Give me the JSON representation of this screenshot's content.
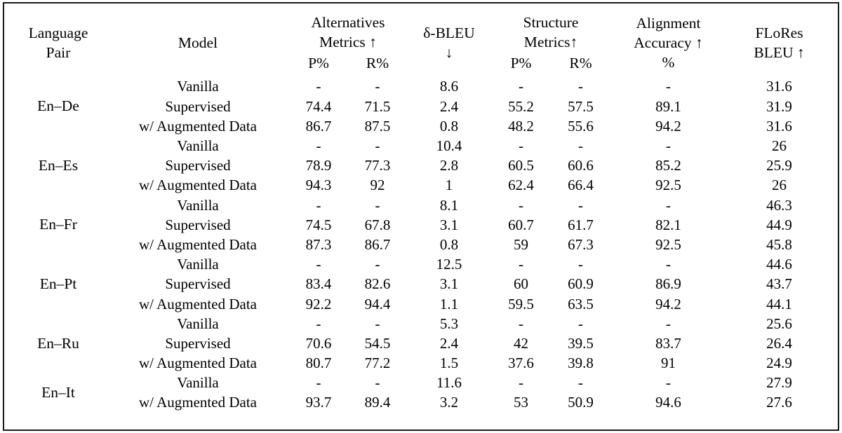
{
  "table": {
    "header": {
      "language_pair": [
        "Language",
        "Pair"
      ],
      "model": "Model",
      "alternatives": {
        "title_line1": "Alternatives",
        "title_line2": "Metrics ↑",
        "sub": [
          "P%",
          "R%"
        ]
      },
      "delta_bleu": {
        "title_line1": "δ-BLEU",
        "title_line2": "↓"
      },
      "structure": {
        "title_line1": "Structure",
        "title_line2": "Metrics↑",
        "sub": [
          "P%",
          "R%"
        ]
      },
      "alignment": {
        "title_line1": "Alignment",
        "title_line2": "Accuracy ↑",
        "title_line3": "%"
      },
      "flores": {
        "title_line1": "FLoRes",
        "title_line2": "BLEU ↑"
      }
    },
    "model_labels": {
      "vanilla": "Vanilla",
      "supervised": "Supervised",
      "augmented": "w/ Augmented Data"
    },
    "dash": "-",
    "groups": [
      {
        "language_pair": "En–De",
        "rows": [
          {
            "model": "Vanilla",
            "alt_p": "-",
            "alt_p_bold": false,
            "alt_r": "-",
            "alt_r_bold": false,
            "dbleu": "8.6",
            "dbleu_bold": false,
            "str_p": "-",
            "str_p_bold": false,
            "str_r": "-",
            "str_r_bold": false,
            "align": "-",
            "align_bold": false,
            "flores": "31.6",
            "flores_bold": false
          },
          {
            "model": "Supervised",
            "alt_p": "74.4",
            "alt_p_bold": false,
            "alt_r": "71.5",
            "alt_r_bold": false,
            "dbleu": "2.4",
            "dbleu_bold": false,
            "str_p": "55.2",
            "str_p_bold": true,
            "str_r": "57.5",
            "str_r_bold": true,
            "align": "89.1",
            "align_bold": false,
            "flores": "31.9",
            "flores_bold": true
          },
          {
            "model": "w/ Augmented Data",
            "alt_p": "86.7",
            "alt_p_bold": true,
            "alt_r": "87.5",
            "alt_r_bold": true,
            "dbleu": "0.8",
            "dbleu_bold": true,
            "str_p": "48.2",
            "str_p_bold": false,
            "str_r": "55.6",
            "str_r_bold": false,
            "align": "94.2",
            "align_bold": true,
            "flores": "31.6",
            "flores_bold": false
          }
        ]
      },
      {
        "language_pair": "En–Es",
        "rows": [
          {
            "model": "Vanilla",
            "alt_p": "-",
            "alt_p_bold": false,
            "alt_r": "-",
            "alt_r_bold": false,
            "dbleu": "10.4",
            "dbleu_bold": false,
            "str_p": "-",
            "str_p_bold": false,
            "str_r": "-",
            "str_r_bold": false,
            "align": "-",
            "align_bold": false,
            "flores": "26",
            "flores_bold": true
          },
          {
            "model": "Supervised",
            "alt_p": "78.9",
            "alt_p_bold": false,
            "alt_r": "77.3",
            "alt_r_bold": false,
            "dbleu": "2.8",
            "dbleu_bold": false,
            "str_p": "60.5",
            "str_p_bold": false,
            "str_r": "60.6",
            "str_r_bold": false,
            "align": "85.2",
            "align_bold": false,
            "flores": "25.9",
            "flores_bold": false
          },
          {
            "model": "w/ Augmented Data",
            "alt_p": "94.3",
            "alt_p_bold": true,
            "alt_r": "92",
            "alt_r_bold": true,
            "dbleu": "1",
            "dbleu_bold": true,
            "str_p": "62.4",
            "str_p_bold": true,
            "str_r": "66.4",
            "str_r_bold": true,
            "align": "92.5",
            "align_bold": true,
            "flores": "26",
            "flores_bold": true
          }
        ]
      },
      {
        "language_pair": "En–Fr",
        "rows": [
          {
            "model": "Vanilla",
            "alt_p": "-",
            "alt_p_bold": false,
            "alt_r": "-",
            "alt_r_bold": false,
            "dbleu": "8.1",
            "dbleu_bold": false,
            "str_p": "-",
            "str_p_bold": false,
            "str_r": "-",
            "str_r_bold": false,
            "align": "-",
            "align_bold": false,
            "flores": "46.3",
            "flores_bold": true
          },
          {
            "model": "Supervised",
            "alt_p": "74.5",
            "alt_p_bold": false,
            "alt_r": "67.8",
            "alt_r_bold": false,
            "dbleu": "3.1",
            "dbleu_bold": false,
            "str_p": "60.7",
            "str_p_bold": true,
            "str_r": "61.7",
            "str_r_bold": false,
            "align": "82.1",
            "align_bold": false,
            "flores": "44.9",
            "flores_bold": false
          },
          {
            "model": "w/ Augmented Data",
            "alt_p": "87.3",
            "alt_p_bold": true,
            "alt_r": "86.7",
            "alt_r_bold": true,
            "dbleu": "0.8",
            "dbleu_bold": true,
            "str_p": "59",
            "str_p_bold": false,
            "str_r": "67.3",
            "str_r_bold": true,
            "align": "92.5",
            "align_bold": true,
            "flores": "45.8",
            "flores_bold": false
          }
        ]
      },
      {
        "language_pair": "En–Pt",
        "rows": [
          {
            "model": "Vanilla",
            "alt_p": "-",
            "alt_p_bold": false,
            "alt_r": "-",
            "alt_r_bold": false,
            "dbleu": "12.5",
            "dbleu_bold": false,
            "str_p": "-",
            "str_p_bold": false,
            "str_r": "-",
            "str_r_bold": false,
            "align": "-",
            "align_bold": false,
            "flores": "44.6",
            "flores_bold": true
          },
          {
            "model": "Supervised",
            "alt_p": "83.4",
            "alt_p_bold": false,
            "alt_r": "82.6",
            "alt_r_bold": false,
            "dbleu": "3.1",
            "dbleu_bold": false,
            "str_p": "60",
            "str_p_bold": true,
            "str_r": "60.9",
            "str_r_bold": false,
            "align": "86.9",
            "align_bold": false,
            "flores": "43.7",
            "flores_bold": false
          },
          {
            "model": "w/ Augmented Data",
            "alt_p": "92.2",
            "alt_p_bold": true,
            "alt_r": "94.4",
            "alt_r_bold": true,
            "dbleu": "1.1",
            "dbleu_bold": true,
            "str_p": "59.5",
            "str_p_bold": false,
            "str_r": "63.5",
            "str_r_bold": true,
            "align": "94.2",
            "align_bold": true,
            "flores": "44.1",
            "flores_bold": false
          }
        ]
      },
      {
        "language_pair": "En–Ru",
        "rows": [
          {
            "model": "Vanilla",
            "alt_p": "-",
            "alt_p_bold": false,
            "alt_r": "-",
            "alt_r_bold": false,
            "dbleu": "5.3",
            "dbleu_bold": false,
            "str_p": "-",
            "str_p_bold": false,
            "str_r": "-",
            "str_r_bold": false,
            "align": "-",
            "align_bold": false,
            "flores": "25.6",
            "flores_bold": false
          },
          {
            "model": "Supervised",
            "alt_p": "70.6",
            "alt_p_bold": false,
            "alt_r": "54.5",
            "alt_r_bold": false,
            "dbleu": "2.4",
            "dbleu_bold": false,
            "str_p": "42",
            "str_p_bold": true,
            "str_r": "39.5",
            "str_r_bold": false,
            "align": "83.7",
            "align_bold": false,
            "flores": "26.4",
            "flores_bold": true
          },
          {
            "model": "w/ Augmented Data",
            "alt_p": "80.7",
            "alt_p_bold": true,
            "alt_r": "77.2",
            "alt_r_bold": true,
            "dbleu": "1.5",
            "dbleu_bold": true,
            "str_p": "37.6",
            "str_p_bold": false,
            "str_r": "39.8",
            "str_r_bold": true,
            "align": "91",
            "align_bold": true,
            "flores": "24.9",
            "flores_bold": false
          }
        ]
      },
      {
        "language_pair": "En–It",
        "rows": [
          {
            "model": "Vanilla",
            "alt_p": "-",
            "alt_p_bold": false,
            "alt_r": "-",
            "alt_r_bold": false,
            "dbleu": "11.6",
            "dbleu_bold": false,
            "str_p": "-",
            "str_p_bold": false,
            "str_r": "-",
            "str_r_bold": false,
            "align": "-",
            "align_bold": false,
            "flores": "27.9",
            "flores_bold": true
          },
          {
            "model": "w/ Augmented Data",
            "alt_p": "93.7",
            "alt_p_bold": false,
            "alt_r": "89.4",
            "alt_r_bold": false,
            "dbleu": "3.2",
            "dbleu_bold": true,
            "str_p": "53",
            "str_p_bold": false,
            "str_r": "50.9",
            "str_r_bold": false,
            "align": "94.6",
            "align_bold": false,
            "flores": "27.6",
            "flores_bold": false
          }
        ]
      }
    ]
  }
}
